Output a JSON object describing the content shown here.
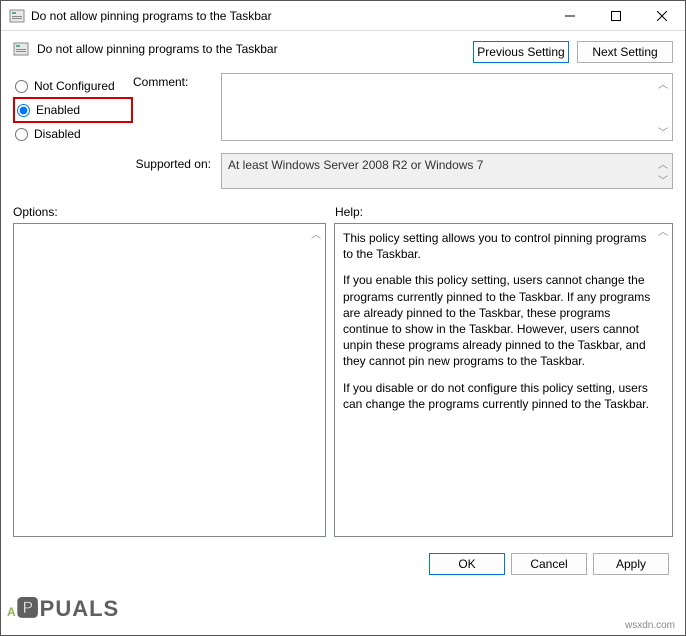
{
  "window": {
    "title": "Do not allow pinning programs to the Taskbar"
  },
  "header": {
    "title": "Do not allow pinning programs to the Taskbar",
    "prev_btn": "Previous Setting",
    "next_btn": "Next Setting"
  },
  "settings": {
    "not_configured": "Not Configured",
    "enabled": "Enabled",
    "disabled": "Disabled",
    "comment_label": "Comment:",
    "comment_value": "",
    "supported_label": "Supported on:",
    "supported_value": "At least Windows Server 2008 R2 or Windows 7"
  },
  "panels": {
    "options_label": "Options:",
    "help_label": "Help:",
    "help_p1": "This policy setting allows you to control pinning programs to the Taskbar.",
    "help_p2": "If you enable this policy setting, users cannot change the programs currently pinned to the Taskbar. If any programs are already pinned to the Taskbar, these programs continue to show in the Taskbar. However, users cannot unpin these programs already pinned to the Taskbar, and they cannot pin new programs to the Taskbar.",
    "help_p3": "If you disable or do not configure this policy setting, users can change the programs currently pinned to the Taskbar."
  },
  "footer": {
    "ok": "OK",
    "cancel": "Cancel",
    "apply": "Apply"
  },
  "watermark": {
    "brand": "A🅿PUALS",
    "site": "wsxdn.com"
  }
}
